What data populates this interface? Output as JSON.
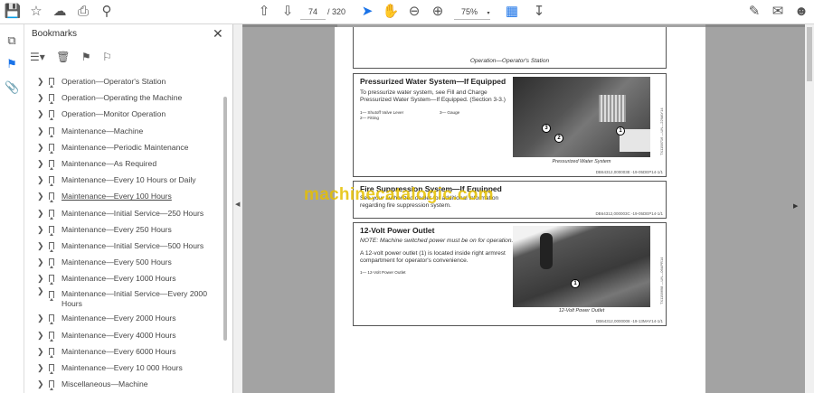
{
  "toolbar": {
    "page_current": "74",
    "page_total": "/ 320",
    "zoom": "75%"
  },
  "bookmarks": {
    "title": "Bookmarks",
    "items": [
      "Operation—Operator's Station",
      "Operation—Operating the Machine",
      "Operation—Monitor Operation",
      "Maintenance—Machine",
      "Maintenance—Periodic Maintenance",
      "Maintenance—As Required",
      "Maintenance—Every 10 Hours or Daily",
      "Maintenance—Every 100 Hours",
      "Maintenance—Initial Service—250 Hours",
      "Maintenance—Every 250 Hours",
      "Maintenance—Initial Service—500 Hours",
      "Maintenance—Every 500 Hours",
      "Maintenance—Every 1000 Hours",
      "Maintenance—Initial Service—Every 2000 Hours",
      "Maintenance—Every 2000 Hours",
      "Maintenance—Every 4000 Hours",
      "Maintenance—Every 6000 Hours",
      "Maintenance—Every 10 000 Hours",
      "Miscellaneous—Machine"
    ]
  },
  "document": {
    "header": "Operation—Operator's Station",
    "sections": [
      {
        "title": "Pressurized Water System—If Equipped",
        "body": "To pressurize water system, see Fill and Charge Pressurized Water System—If Equipped. (Section 3-3.)",
        "legend_a": "1— Shutoff Valve Lever",
        "legend_b": "2— Fitting",
        "legend_c": "3— Gauge",
        "caption": "Pressurized Water System",
        "side_code": "TX1158716 —UN—22MAY14",
        "code": "DB64312,000003E -19-05DEP14-1/1"
      },
      {
        "title": "Fire Suppression System—If Equipped",
        "body": "See your authorized dealer for additional information regarding fire suppression system.",
        "code": "DB64312,000003C -19-05DEP14-1/1"
      },
      {
        "title": "12-Volt Power Outlet",
        "note": "NOTE: Machine switched power must be on for operation.",
        "body": "A 12-volt power outlet (1) is located inside right armrest compartment for operator's convenience.",
        "legend_a": "1— 12-Volt Power Outlet",
        "caption": "12-Volt Power Outlet",
        "side_code": "TX1158698 —UN—06APR14",
        "code": "DB64312,0000008 -19-13MAY14-1/1"
      }
    ],
    "watermark": "machinecatalogic.com"
  },
  "colors": {
    "accent": "#1a73e8",
    "watermark": "#e6c000",
    "doc_background": "#a3a3a3"
  }
}
